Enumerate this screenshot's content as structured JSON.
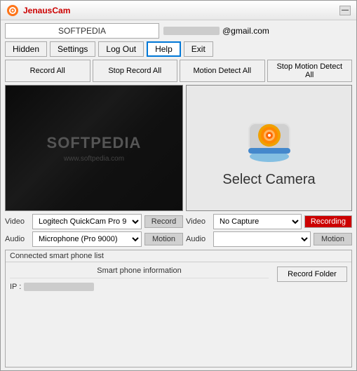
{
  "window": {
    "title": "JenausCam",
    "minimize_label": "—"
  },
  "top": {
    "softpedia_label": "SOFTPEDIA",
    "email_suffix": "@gmail.com"
  },
  "nav_buttons": {
    "hidden": "Hidden",
    "settings": "Settings",
    "logout": "Log Out",
    "help": "Help",
    "exit": "Exit"
  },
  "action_buttons": {
    "record_all": "Record All",
    "stop_record_all": "Stop Record All",
    "motion_detect_all": "Motion Detect All",
    "stop_motion_detect_all": "Stop Motion Detect All"
  },
  "camera_left": {
    "title": "SOFTPEDIA",
    "url": "www.softpedia.com"
  },
  "camera_right": {
    "label": "Select Camera"
  },
  "controls_left": {
    "video_label": "Video",
    "audio_label": "Audio",
    "video_device": "Logitech QuickCam Pro 9",
    "audio_device": "Microphone (Pro 9000)",
    "record_btn": "Record",
    "motion_btn": "Motion"
  },
  "controls_right": {
    "video_label": "Video",
    "audio_label": "Audio",
    "video_device": "No Capture",
    "audio_device": "",
    "recording_btn": "Recording",
    "motion_btn": "Motion"
  },
  "phone_section": {
    "header": "Connected smart phone list",
    "info_header": "Smart phone information",
    "ip_label": "IP :",
    "record_folder_btn": "Record Folder"
  }
}
